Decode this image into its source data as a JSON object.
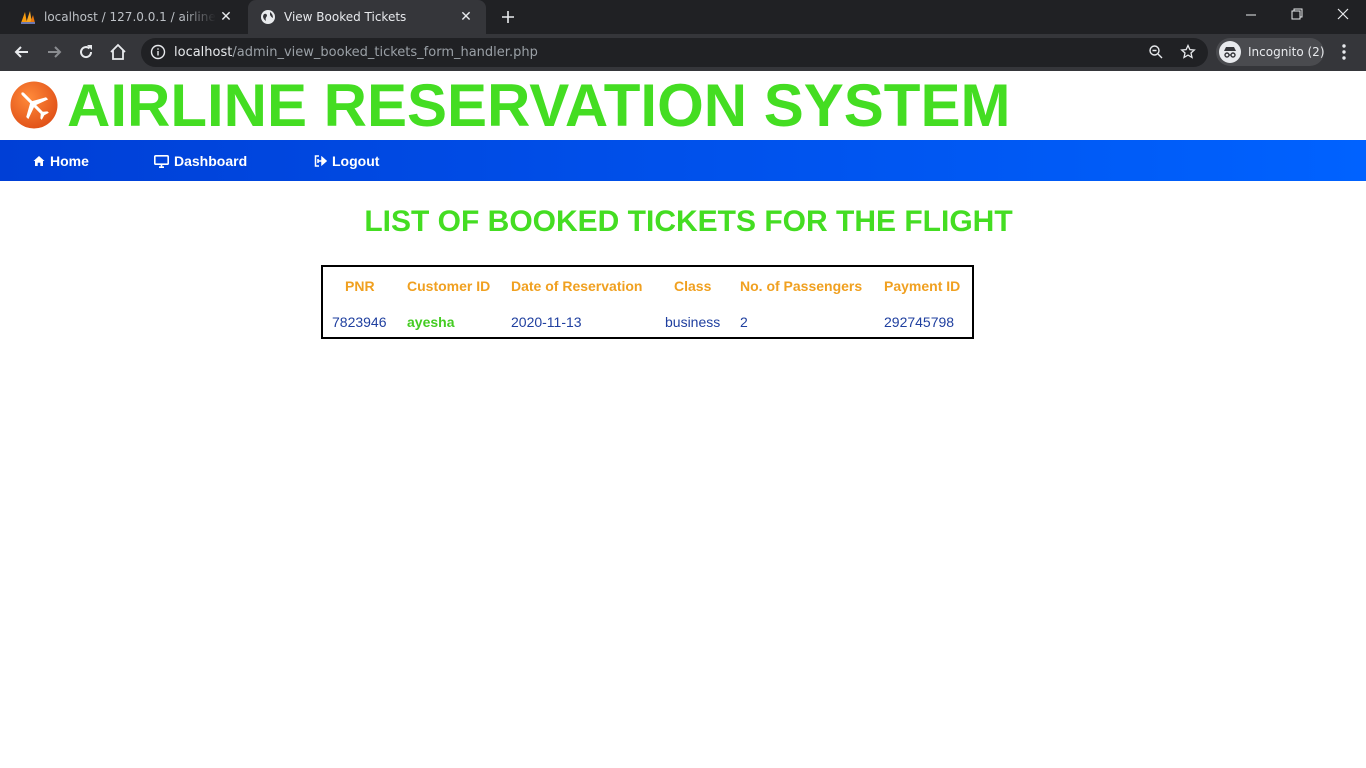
{
  "browser": {
    "tabs": [
      {
        "title": "localhost / 127.0.0.1 / airline rese",
        "active": false,
        "icon": "phpmyadmin-icon"
      },
      {
        "title": "View Booked Tickets",
        "active": true,
        "icon": "globe-icon"
      }
    ],
    "address_bar": {
      "host": "localhost",
      "path": "/admin_view_booked_tickets_form_handler.php"
    },
    "profile_label": "Incognito (2)"
  },
  "header": {
    "title": "AIRLINE RESERVATION SYSTEM",
    "logo_icon": "airplane-icon"
  },
  "nav": {
    "items": [
      {
        "label": "Home",
        "icon": "home-icon"
      },
      {
        "label": "Dashboard",
        "icon": "desktop-icon"
      },
      {
        "label": "Logout",
        "icon": "logout-icon"
      }
    ]
  },
  "main": {
    "heading": "LIST OF BOOKED TICKETS FOR THE FLIGHT",
    "table": {
      "columns": [
        "PNR",
        "Customer ID",
        "Date of Reservation",
        "Class",
        "No. of Passengers",
        "Payment ID"
      ],
      "rows": [
        [
          "7823946",
          "ayesha",
          "2020-11-13",
          "business",
          "2",
          "292745798"
        ]
      ]
    }
  },
  "colors": {
    "title_green": "#44dd22",
    "nav_blue": "#0062ff",
    "header_orange": "#f0a020",
    "cell_blue": "#1f3f9f"
  }
}
